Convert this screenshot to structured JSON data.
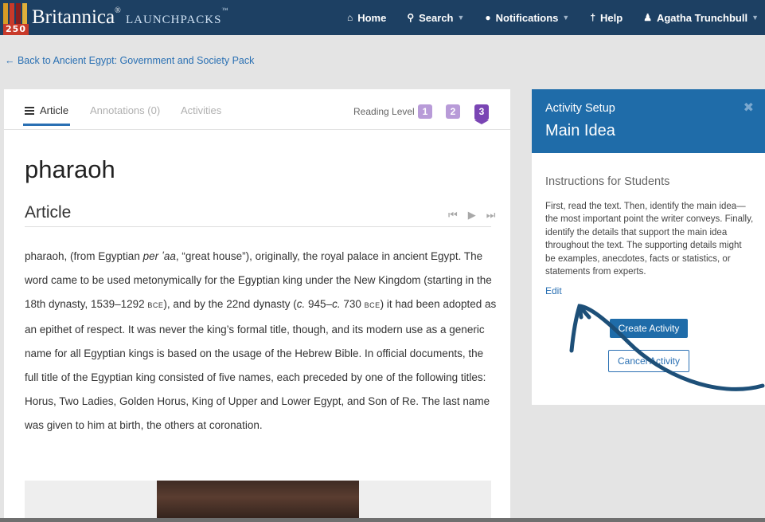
{
  "header": {
    "badge_number": "250",
    "brand": "Britannica",
    "product": "LaunchPacks",
    "nav": [
      {
        "icon": "home-icon",
        "glyph": "⌂",
        "label": "Home",
        "caret": false
      },
      {
        "icon": "search-icon",
        "glyph": "⚲",
        "label": "Search",
        "caret": true
      },
      {
        "icon": "comment-icon",
        "glyph": "●",
        "label": "Notifications",
        "caret": true
      },
      {
        "icon": "lightbulb-icon",
        "glyph": "†",
        "label": "Help",
        "caret": false
      },
      {
        "icon": "user-icon",
        "glyph": "♟",
        "label": "Agatha Trunchbull",
        "caret": true
      }
    ]
  },
  "back_link": "← Back to Ancient Egypt: Government and Society Pack",
  "article_panel": {
    "tabs": [
      "Article",
      "Annotations (0)",
      "Activities"
    ],
    "reading_level_label": "Reading Level",
    "levels": [
      "1",
      "2",
      "3"
    ],
    "selected_level": "3",
    "title": "pharaoh",
    "section_heading": "Article",
    "body": {
      "p1": "pharaoh,  (from Egyptian ",
      "p1_italic": "per ʽaa",
      "p2": ", “great house”), originally, the royal palace in ancient Egypt. The word came to be used metonymically for the Egyptian king under the New Kingdom (starting in the 18th dynasty, 1539–1292 ",
      "bce1": "BCE",
      "p3": "), and by the 22nd dynasty (",
      "c1": "c.",
      "p4": " 945–",
      "c2": "c.",
      "p5": " 730 ",
      "bce2": "BCE",
      "p6": ") it had been adopted as an epithet of respect. It was never the king’s formal title, though, and its modern use as a generic name for all Egyptian kings is based on the usage of the Hebrew Bible. In official documents, the full title of the Egyptian king consisted of five names, each preceded by one of the following titles: Horus, Two Ladies, Golden Horus, King of Upper and Lower Egypt, and Son of Re. The last name was given to him at birth, the others at coronation."
    }
  },
  "activity_panel": {
    "label": "Activity Setup",
    "title": "Main Idea",
    "instructions_heading": "Instructions for Students",
    "instructions": "First, read the text. Then, identify the main idea—the most important point the writer conveys. Finally, identify the details that support the main idea throughout the text. The supporting details might be examples, anecdotes, facts or statistics, or statements from experts.",
    "edit_label": "Edit",
    "create_button": "Create Activity",
    "cancel_button": "Cancel Activity"
  },
  "colors": {
    "header_bg": "#1d4063",
    "accent_blue": "#1f6ca9",
    "link_blue": "#2a70b3",
    "level_selected": "#7a45b4",
    "level_unselected": "#b89bd8",
    "annotation_arrow": "#1d4f78"
  }
}
